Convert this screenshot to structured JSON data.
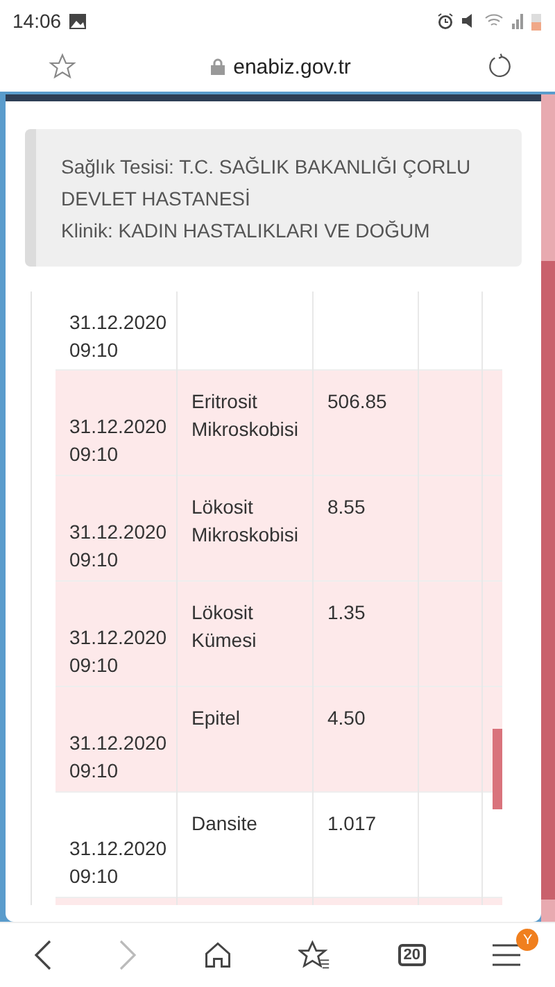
{
  "status_bar": {
    "time": "14:06"
  },
  "address_bar": {
    "url": "enabiz.gov.tr"
  },
  "info_box": {
    "lines": [
      "Sağlık Tesisi: T.C. SAĞLIK BAKANLIĞI ÇORLU DEVLET HASTANESİ",
      "Klinik: KADIN HASTALIKLARI VE DOĞUM"
    ]
  },
  "table": {
    "rows": [
      {
        "date": "31.12.2020\n09:10",
        "test": "",
        "value": "",
        "highlighted": false
      },
      {
        "date": "31.12.2020\n09:10",
        "test": "Eritrosit Mikroskobisi",
        "value": "506.85",
        "highlighted": true
      },
      {
        "date": "31.12.2020\n09:10",
        "test": "Lökosit Mikroskobisi",
        "value": "8.55",
        "highlighted": true
      },
      {
        "date": "31.12.2020\n09:10",
        "test": "Lökosit Kümesi",
        "value": "1.35",
        "highlighted": true
      },
      {
        "date": "31.12.2020\n09:10",
        "test": "Epitel",
        "value": "4.50",
        "highlighted": true
      },
      {
        "date": "31.12.2020\n09:10",
        "test": "Dansite",
        "value": "1.017",
        "highlighted": false
      },
      {
        "date": "",
        "test": "",
        "value": "",
        "highlighted": true
      }
    ]
  },
  "bottom_nav": {
    "tabs_count": "20",
    "menu_badge": "Y",
    "forward_disabled": true
  }
}
